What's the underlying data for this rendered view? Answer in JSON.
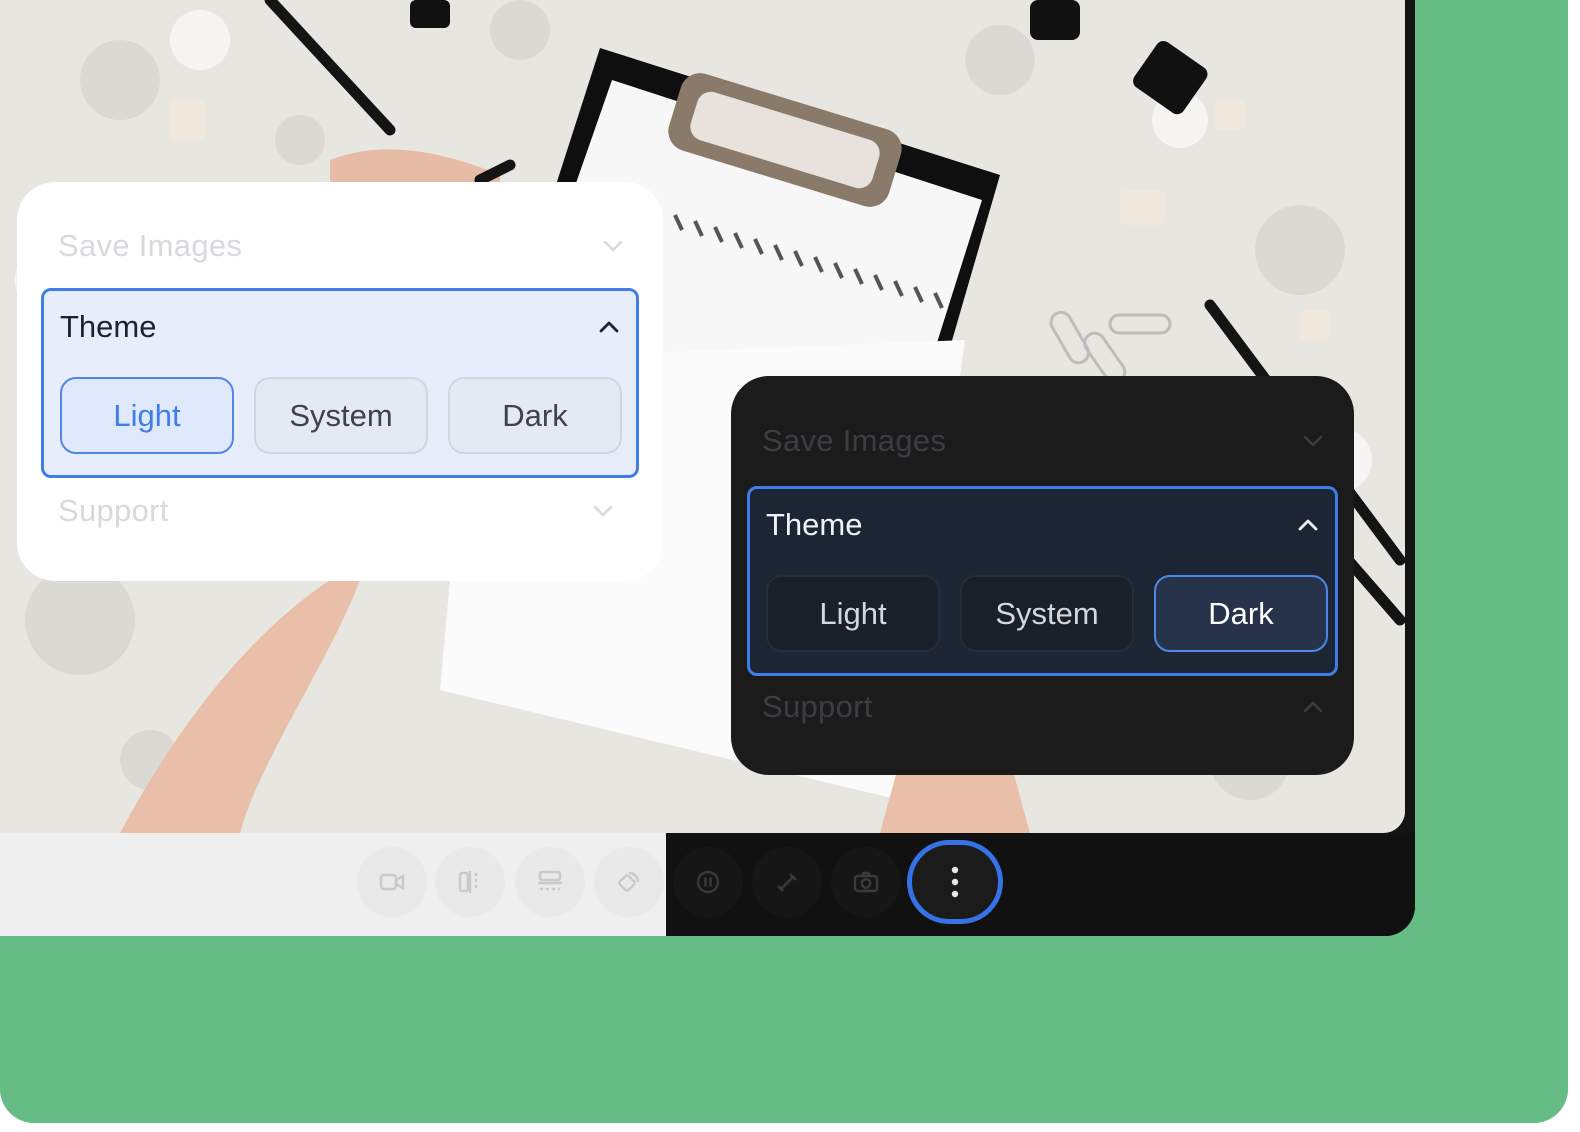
{
  "colors": {
    "accent": "#3f7ee8",
    "background_green": "#65bd85",
    "light_panel": "#ffffff",
    "dark_panel": "#1b1b1b"
  },
  "light_panel": {
    "save_images": "Save Images",
    "theme": {
      "label": "Theme",
      "options": [
        "Light",
        "System",
        "Dark"
      ],
      "selected": "Light"
    },
    "support": "Support"
  },
  "dark_panel": {
    "save_images": "Save Images",
    "theme": {
      "label": "Theme",
      "options": [
        "Light",
        "System",
        "Dark"
      ],
      "selected": "Dark"
    },
    "support": "Support"
  },
  "toolbar": {
    "buttons": [
      "video-icon",
      "split-vertical-icon",
      "split-horizontal-icon",
      "rotate-icon",
      "pause-icon",
      "brush-icon",
      "camera-icon",
      "more-vertical-icon"
    ]
  }
}
